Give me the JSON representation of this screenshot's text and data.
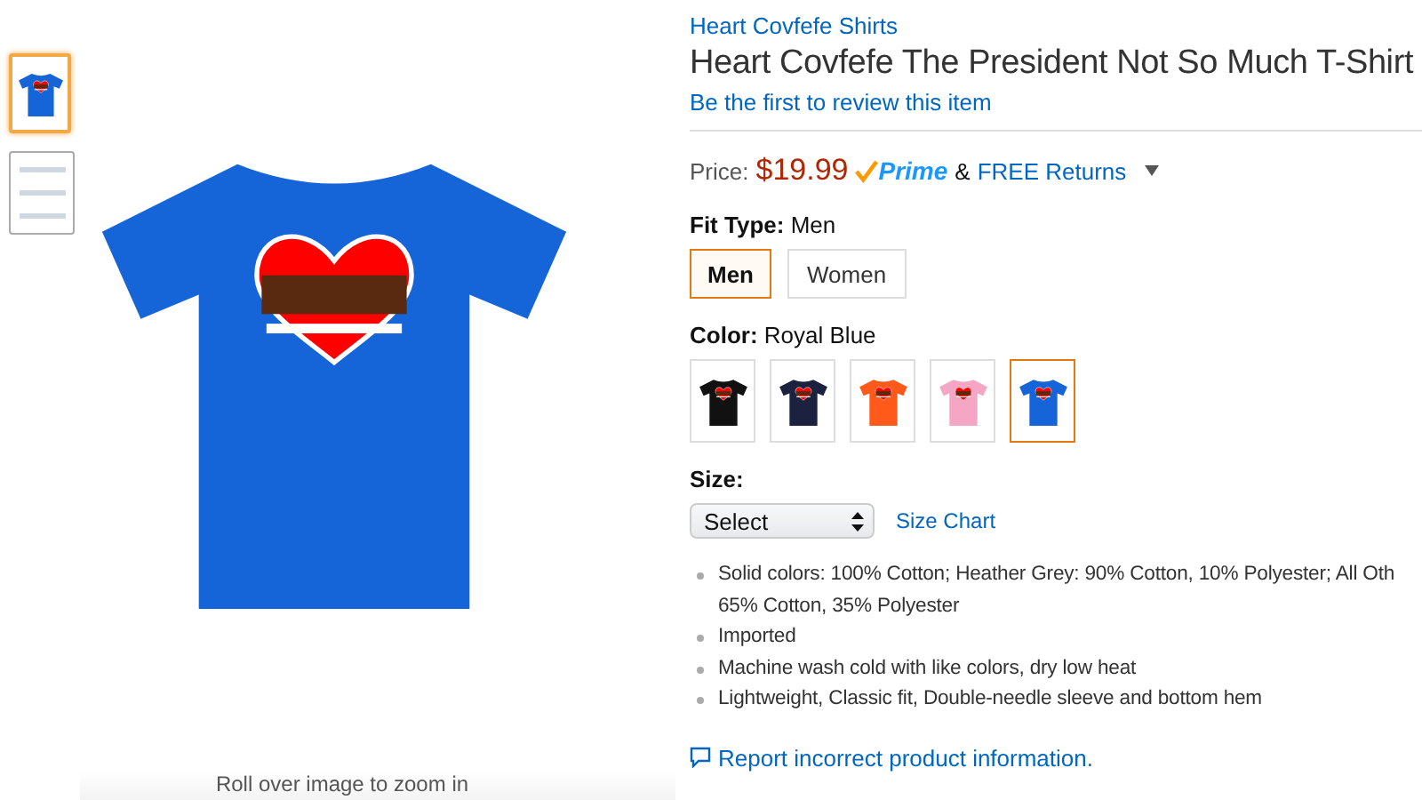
{
  "gallery": {
    "thumbnails": [
      {
        "kind": "shirt",
        "selected": true
      },
      {
        "kind": "sheet",
        "selected": false
      }
    ],
    "caption": "Roll over image to zoom in"
  },
  "product": {
    "brand": "Heart Covfefe Shirts",
    "title": "Heart Covfefe The President Not So Much T-Shirt",
    "review_link": "Be the first to review this item",
    "price": {
      "label": "Price:",
      "amount": "$19.99",
      "prime_logo": "Prime",
      "ampersand": "&",
      "returns_link": "FREE Returns"
    },
    "fit_type": {
      "label": "Fit Type:",
      "value": "Men",
      "options": [
        {
          "label": "Men",
          "selected": true
        },
        {
          "label": "Women",
          "selected": false
        }
      ]
    },
    "color": {
      "label": "Color:",
      "value": "Royal Blue",
      "swatches": [
        {
          "color": "#111111",
          "selected": false
        },
        {
          "color": "#1c2140",
          "selected": false
        },
        {
          "color": "#ff5a1a",
          "selected": false
        },
        {
          "color": "#f4a6c4",
          "selected": false
        },
        {
          "color": "#1565d8",
          "selected": true
        }
      ]
    },
    "size": {
      "label": "Size:",
      "select_value": "Select",
      "size_chart_link": "Size Chart"
    },
    "bullets": [
      [
        "Solid colors: 100% Cotton; Heather Grey: 90% Cotton, 10% Polyester; All Oth",
        "65% Cotton, 35% Polyester"
      ],
      [
        "Imported"
      ],
      [
        "Machine wash cold with like colors, dry low heat"
      ],
      [
        "Lightweight, Classic fit, Double-needle sleeve and bottom hem"
      ]
    ],
    "report_link": "Report incorrect product information."
  }
}
